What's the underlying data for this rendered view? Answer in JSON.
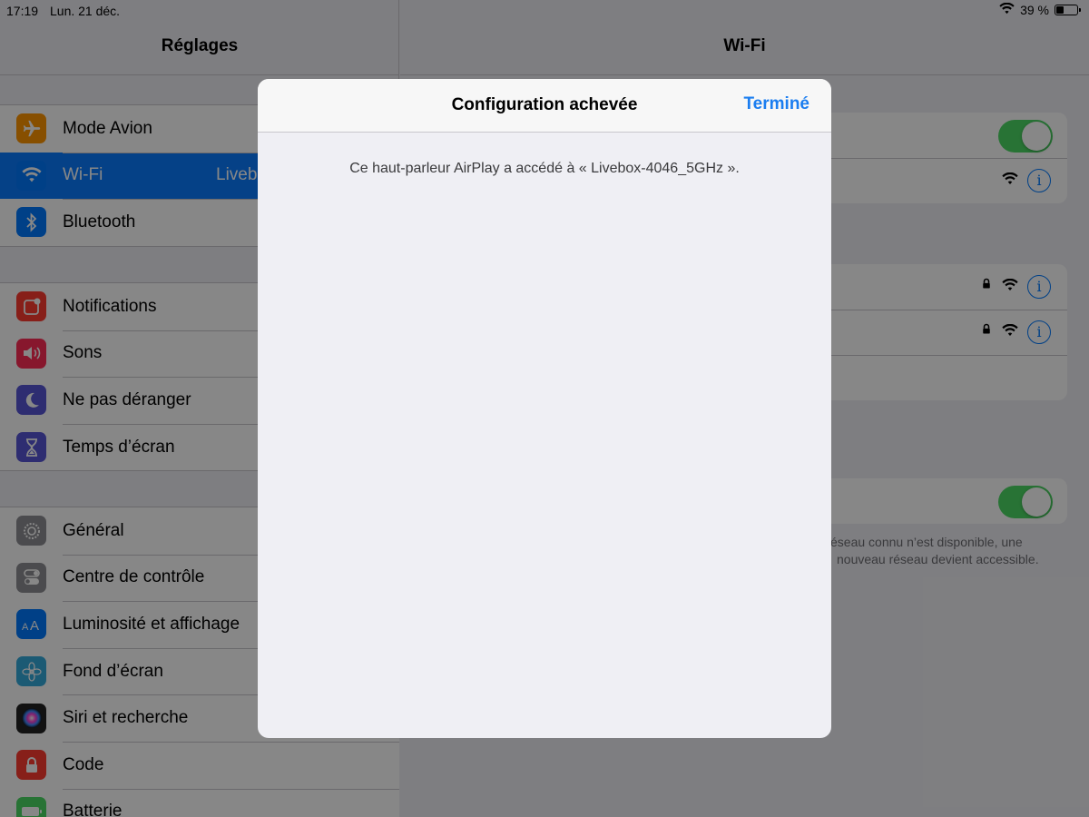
{
  "status_bar": {
    "time": "17:19",
    "date": "Lun. 21 déc.",
    "battery_percent": "39 %",
    "battery_level": 0.39
  },
  "sidebar": {
    "title": "Réglages",
    "groups": [
      [
        {
          "label": "Mode Avion",
          "icon": "airplane-icon",
          "color": "#ff9500"
        },
        {
          "label": "Wi-Fi",
          "value": "Liveb",
          "icon": "wifi-icon",
          "color": "#007aff",
          "selected": true
        },
        {
          "label": "Bluetooth",
          "icon": "bluetooth-icon",
          "color": "#007aff"
        }
      ],
      [
        {
          "label": "Notifications",
          "icon": "notifications-icon",
          "color": "#ff3b30"
        },
        {
          "label": "Sons",
          "icon": "speaker-icon",
          "color": "#ff2d55"
        },
        {
          "label": "Ne pas déranger",
          "icon": "moon-icon",
          "color": "#5856d6"
        },
        {
          "label": "Temps d’écran",
          "icon": "hourglass-icon",
          "color": "#5856d6"
        }
      ],
      [
        {
          "label": "Général",
          "icon": "gear-icon",
          "color": "#8e8e93"
        },
        {
          "label": "Centre de contrôle",
          "icon": "switches-icon",
          "color": "#8e8e93"
        },
        {
          "label": "Luminosité et affichage",
          "icon": "text-size-icon",
          "color": "#007aff"
        },
        {
          "label": "Fond d’écran",
          "icon": "flower-icon",
          "color": "#34aadc"
        },
        {
          "label": "Siri et recherche",
          "icon": "siri-icon",
          "color": "#222222"
        },
        {
          "label": "Code",
          "icon": "lock-icon",
          "color": "#ff3b30"
        },
        {
          "label": "Batterie",
          "icon": "battery-icon",
          "color": "#4cd964"
        }
      ]
    ]
  },
  "detail": {
    "title": "Wi-Fi",
    "footnote_line1": "éseau connu n’est disponible, une",
    "footnote_line2": "nouveau réseau devient accessible."
  },
  "modal": {
    "title": "Configuration achevée",
    "done_label": "Terminé",
    "message": "Ce haut-parleur AirPlay a accédé à « Livebox-4046_5GHz »."
  },
  "colors": {
    "accent": "#1a7df0",
    "toggle_on": "#4cd964",
    "selected_row": "#0a7bff"
  }
}
